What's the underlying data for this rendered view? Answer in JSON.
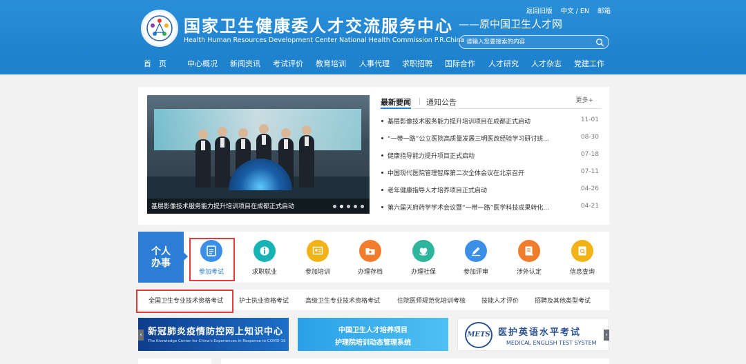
{
  "header": {
    "title": "国家卫生健康委人才交流服务中心",
    "subtitle": "Health Human Resources Development Center National Health Commission P.R.China",
    "former_name": "——原中国卫生人才网",
    "top_links": [
      "返回旧版",
      "中文 / EN",
      "邮箱"
    ],
    "search_placeholder": "请输入您要搜索的内容"
  },
  "nav": [
    "首　页",
    "中心概况",
    "新闻资讯",
    "考试评价",
    "教育培训",
    "人事代理",
    "求职招聘",
    "国际合作",
    "人才研究",
    "人才杂志",
    "党建工作"
  ],
  "banner": {
    "caption": "基层影像技术服务能力提升培训项目在成都正式启动",
    "slide_count": 5,
    "active_slide": 1
  },
  "news": {
    "tabs": [
      "最新要闻",
      "通知公告"
    ],
    "more": "更多+",
    "items": [
      {
        "title": "基层影像技术服务能力提升培训项目在成都正式启动",
        "date": "11-01"
      },
      {
        "title": "“一带一路”公立医院高质量发展三明医改经验学习研讨班...",
        "date": "08-30"
      },
      {
        "title": "健康指导能力提升项目正式启动",
        "date": "07-18"
      },
      {
        "title": "中国现代医院管理智库第二次全体会议在北京召开",
        "date": "07-11"
      },
      {
        "title": "老年健康指导人才培养项目正式启动",
        "date": "04-26"
      },
      {
        "title": "第六届天府药学学术会议暨“一带一路”医学科技成果转化...",
        "date": "04-21"
      }
    ]
  },
  "services": {
    "personal_line1": "个人",
    "personal_line2": "办事",
    "items": [
      {
        "label": "参加考试",
        "icon": "exam-icon",
        "color": "#3c8fe6"
      },
      {
        "label": "求职就业",
        "icon": "job-icon",
        "color": "#17b3b5"
      },
      {
        "label": "参加培训",
        "icon": "training-icon",
        "color": "#f2b316"
      },
      {
        "label": "办理存档",
        "icon": "archive-icon",
        "color": "#f07d2c"
      },
      {
        "label": "办理社保",
        "icon": "social-security-icon",
        "color": "#2fb59b"
      },
      {
        "label": "参加评审",
        "icon": "review-icon",
        "color": "#3c8fe6"
      },
      {
        "label": "涉外认定",
        "icon": "foreign-cert-icon",
        "color": "#f07d2c"
      },
      {
        "label": "信息查询",
        "icon": "info-query-icon",
        "color": "#f2b316"
      }
    ]
  },
  "subtabs": [
    "全国卫生专业技术资格考试",
    "护士执业资格考试",
    "高级卫生专业技术资格考试",
    "住院医师规范化培训考核",
    "技能人才评价",
    "招聘及其他类型考试"
  ],
  "promos": {
    "p1_title": "新冠肺炎疫情防控网上知识中心",
    "p1_sub": "The Knowledge Center for China's Experiences in Response to COVID-19",
    "p2_line1": "中国卫生人才培养项目",
    "p2_line2": "护理院培训动态管理系统",
    "p3_logo": "METS",
    "p3_cn": "医护英语水平考试",
    "p3_en": "MEDICAL ENGLISH TEST SYSTEM",
    "left_arrow": "‹",
    "right_arrow": "›"
  }
}
